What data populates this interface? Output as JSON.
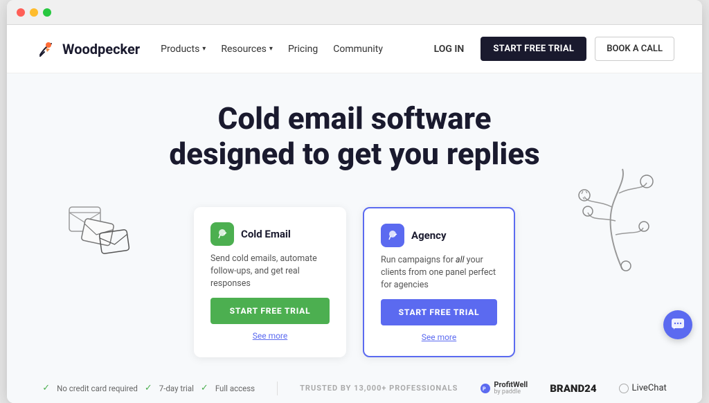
{
  "browser": {
    "dots": [
      "red",
      "yellow",
      "green"
    ]
  },
  "nav": {
    "logo_text": "Woodpecker",
    "links": [
      {
        "label": "Products",
        "has_chevron": true
      },
      {
        "label": "Resources",
        "has_chevron": true
      },
      {
        "label": "Pricing",
        "has_chevron": false
      },
      {
        "label": "Community",
        "has_chevron": false
      }
    ],
    "login_label": "LOG IN",
    "start_trial_label": "START FREE TRIAL",
    "book_call_label": "BOOK A CALL"
  },
  "hero": {
    "title_line1": "Cold email software",
    "title_line2": "designed to get you replies"
  },
  "cards": [
    {
      "id": "cold-email",
      "title": "Cold Email",
      "icon_color": "green",
      "description": "Send cold emails, automate follow-ups, and get real responses",
      "cta_label": "START FREE TRIAL",
      "see_more_label": "See more"
    },
    {
      "id": "agency",
      "title": "Agency",
      "icon_color": "blue",
      "description": "Run campaigns for all your clients from one panel perfect for agencies",
      "cta_label": "START FREE TRIAL",
      "see_more_label": "See more"
    }
  ],
  "trust": {
    "badges": [
      {
        "icon": "check",
        "label": "No credit card required"
      },
      {
        "icon": "check",
        "label": "7-day trial"
      },
      {
        "icon": "check",
        "label": "Full access"
      }
    ],
    "trusted_label": "TRUSTED BY 13,000+ PROFESSIONALS",
    "brands": [
      {
        "name": "ProfitWell",
        "sub": "by paddle"
      },
      {
        "name": "BRAND24"
      },
      {
        "name": "LiveChat"
      }
    ]
  },
  "chat_button": {
    "icon": "💬"
  }
}
